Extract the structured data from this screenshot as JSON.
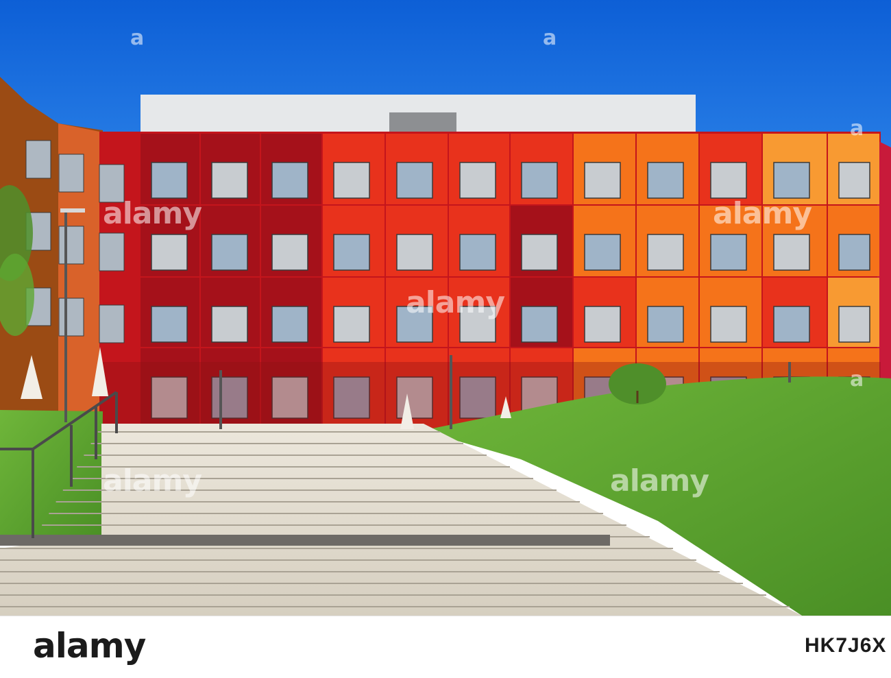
{
  "photo": {
    "subject": "",
    "colors": {
      "sky": "#1a6fe0",
      "dark_red": "#a5111a",
      "red": "#e8321c",
      "orange": "#f5731a",
      "light_orange": "#f89a32",
      "grass": "#5ea832",
      "steps": "#ddd7ca"
    }
  },
  "watermark": {
    "text": "alamy",
    "top_marks": "a"
  },
  "footer": {
    "brand": "alamy",
    "image_id": "HK7J6X"
  }
}
